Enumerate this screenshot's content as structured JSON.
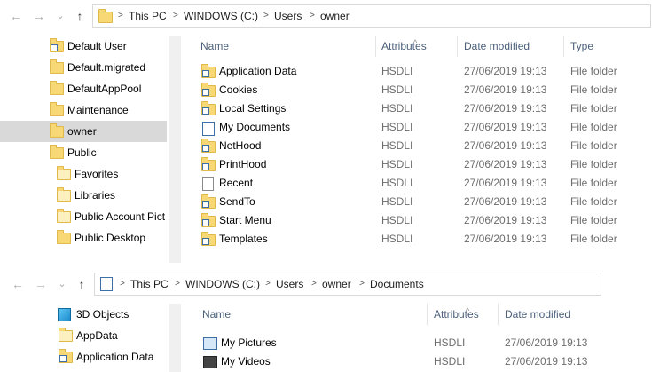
{
  "window_top": {
    "breadcrumb": [
      "This PC",
      "WINDOWS (C:)",
      "Users",
      "owner"
    ],
    "tree": [
      {
        "label": "Default User",
        "icon": "link-folder-icon",
        "state": "normal"
      },
      {
        "label": "Default.migrated",
        "icon": "folder-icon",
        "state": "normal"
      },
      {
        "label": "DefaultAppPool",
        "icon": "folder-icon",
        "state": "normal"
      },
      {
        "label": "Maintenance",
        "icon": "folder-icon",
        "state": "normal"
      },
      {
        "label": "owner",
        "icon": "folder-icon",
        "state": "selected"
      },
      {
        "label": "Public",
        "icon": "folder-icon",
        "state": "normal"
      },
      {
        "label": "Favorites",
        "icon": "folder-icon",
        "state": "child"
      },
      {
        "label": "Libraries",
        "icon": "folder-icon",
        "state": "child"
      },
      {
        "label": "Public Account Pict",
        "icon": "folder-icon",
        "state": "child"
      },
      {
        "label": "Public Desktop",
        "icon": "folder-icon",
        "state": "child"
      }
    ],
    "columns": {
      "name": "Name",
      "attributes": "Attributes",
      "date": "Date modified",
      "type": "Type"
    },
    "rows": [
      {
        "name": "Application Data",
        "icon": "link-folder-icon",
        "attr": "HSDLI",
        "date": "27/06/2019 19:13",
        "type": "File folder"
      },
      {
        "name": "Cookies",
        "icon": "link-folder-icon",
        "attr": "HSDLI",
        "date": "27/06/2019 19:13",
        "type": "File folder"
      },
      {
        "name": "Local Settings",
        "icon": "link-folder-icon",
        "attr": "HSDLI",
        "date": "27/06/2019 19:13",
        "type": "File folder"
      },
      {
        "name": "My Documents",
        "icon": "documents-icon",
        "attr": "HSDLI",
        "date": "27/06/2019 19:13",
        "type": "File folder"
      },
      {
        "name": "NetHood",
        "icon": "link-folder-icon",
        "attr": "HSDLI",
        "date": "27/06/2019 19:13",
        "type": "File folder"
      },
      {
        "name": "PrintHood",
        "icon": "link-folder-icon",
        "attr": "HSDLI",
        "date": "27/06/2019 19:13",
        "type": "File folder"
      },
      {
        "name": "Recent",
        "icon": "recent-icon",
        "attr": "HSDLI",
        "date": "27/06/2019 19:13",
        "type": "File folder"
      },
      {
        "name": "SendTo",
        "icon": "link-folder-icon",
        "attr": "HSDLI",
        "date": "27/06/2019 19:13",
        "type": "File folder"
      },
      {
        "name": "Start Menu",
        "icon": "link-folder-icon",
        "attr": "HSDLI",
        "date": "27/06/2019 19:13",
        "type": "File folder"
      },
      {
        "name": "Templates",
        "icon": "link-folder-icon",
        "attr": "HSDLI",
        "date": "27/06/2019 19:13",
        "type": "File folder"
      }
    ]
  },
  "window_bottom": {
    "breadcrumb": [
      "This PC",
      "WINDOWS (C:)",
      "Users",
      "owner",
      "Documents"
    ],
    "tree": [
      {
        "label": "3D Objects",
        "icon": "3d-objects-icon"
      },
      {
        "label": "AppData",
        "icon": "folder-icon"
      },
      {
        "label": "Application Data",
        "icon": "link-folder-icon"
      }
    ],
    "columns": {
      "name": "Name",
      "attributes": "Attributes",
      "date": "Date modified"
    },
    "rows": [
      {
        "name": "My Pictures",
        "icon": "pictures-icon",
        "attr": "HSDLI",
        "date": "27/06/2019 19:13"
      },
      {
        "name": "My Videos",
        "icon": "videos-icon",
        "attr": "HSDLI",
        "date": "27/06/2019 19:13"
      }
    ]
  },
  "nav": {
    "back": "←",
    "forward": "→",
    "recent": "⌄",
    "up": "↑"
  }
}
